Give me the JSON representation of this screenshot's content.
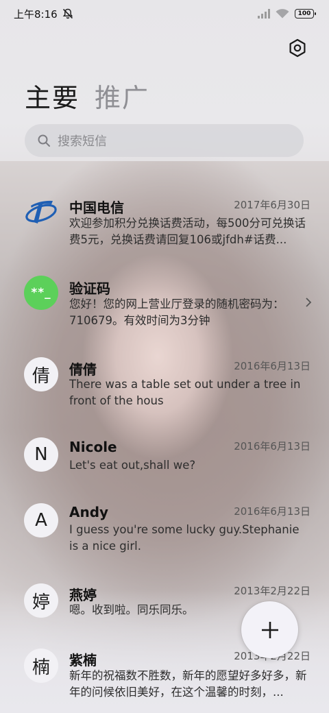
{
  "status_bar": {
    "time": "上午8:16",
    "battery": "100",
    "icons": [
      "mute-icon",
      "signal-icon",
      "wifi-icon",
      "battery-icon"
    ]
  },
  "header": {
    "settings_icon": "settings-icon",
    "tabs": [
      {
        "label": "主要",
        "active": true
      },
      {
        "label": "推广",
        "active": false
      }
    ]
  },
  "search": {
    "placeholder": "搜索短信",
    "icon": "search-icon"
  },
  "conversations": [
    {
      "name": "中国电信",
      "date": "2017年6月30日",
      "preview": "欢迎参加积分兑换话费活动，每500分可兑换话费5元，兑换话费请回复106或jfdh#话费...",
      "avatar": "china-telecom-logo"
    },
    {
      "name": "验证码",
      "date": "",
      "preview": "您好！您的网上营业厅登录的随机密码为：710679。有效时间为3分钟",
      "avatar_text": "**_",
      "avatar_color": "#5cd05a"
    },
    {
      "name": "倩倩",
      "date": "2016年6月13日",
      "preview": "There was a table set out under a tree in front of the hous",
      "avatar_text": "倩"
    },
    {
      "name": "Nicole",
      "date": "2016年6月13日",
      "preview": "Let's eat out,shall we?",
      "avatar_text": "N"
    },
    {
      "name": "Andy",
      "date": "2016年6月13日",
      "preview": "I guess you're some lucky guy.Stephanie is a nice girl.",
      "avatar_text": "A"
    },
    {
      "name": "燕婷",
      "date": "2013年2月22日",
      "preview": "嗯。收到啦。同乐同乐。",
      "avatar_text": "婷"
    },
    {
      "name": "紫楠",
      "date": "2013年2月22日",
      "preview": "新年的祝福数不胜数，新年的愿望好多好多，新年的问候依旧美好，在这个温馨的时刻，...",
      "avatar_text": "楠"
    }
  ],
  "fab": {
    "icon": "plus-icon",
    "label": "+"
  }
}
